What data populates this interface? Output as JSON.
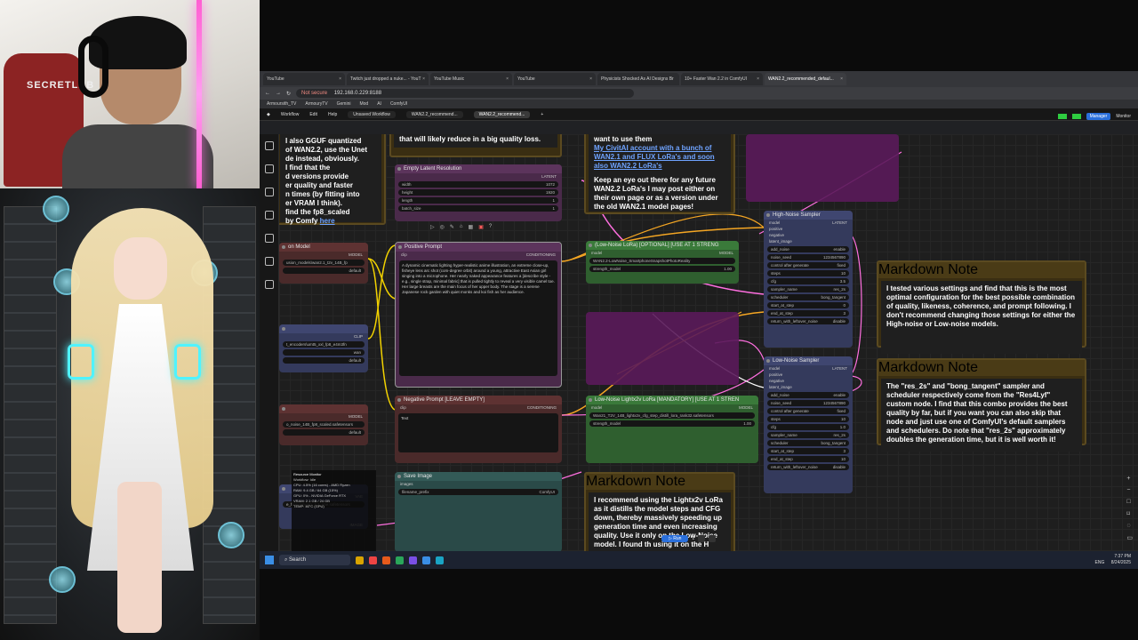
{
  "browser": {
    "tabs": [
      "YouTube",
      "Twitch just dropped a nuke... - YouT",
      "YouTube Music",
      "YouTube",
      "Physicists Shocked As AI Designs Br",
      "10+ Faster Wan 2.2 in ComfyUI",
      "WAN2.2_recommended_defaul..."
    ],
    "not_secure": "Not secure",
    "url": "192.168.0.229:8188",
    "bookmarks": [
      "Armoursith_TV",
      "ArmouryTV",
      "Gemini",
      "Mod",
      "AI",
      "ComfyUI"
    ]
  },
  "comfy": {
    "menu": [
      "Workflow",
      "Edit",
      "Help"
    ],
    "workflow_tabs": [
      "Unsaved Workflow",
      "WAN2.2_recommend...",
      "WAN2.2_recommend..."
    ],
    "manager": "Manager",
    "monitor": "Monitor",
    "run": "Run",
    "run_count": "1"
  },
  "notes": {
    "top_left": {
      "lines": [
        "I also GGUF quantized",
        "of WAN2.2, use the Unet",
        "de instead, obviously.",
        "I find that the",
        "d versions provide",
        "er quality and faster",
        "n times (by fitting into",
        "er VRAM I think).",
        "find the fp8_scaled",
        "by Comfy "
      ],
      "link": "here"
    },
    "top_mid_text": "that will likely reduce in a big quality loss.",
    "top_right": {
      "intro": "want to use them",
      "link": "My CivitAI account with a bunch of WAN2.1 and FLUX LoRa's and soon also WAN2.2 LoRa's",
      "text": "Keep an eye out there for any future WAN2.2 LoRa's I may post either on their own page or as a version under the old WAN2.1 model pages!"
    },
    "md1": {
      "title": "Markdown Note",
      "text": "I tested various settings and find that this is the most optimal configuration for the best possible combination of quality, likeness, coherence, and prompt following. I don't recommend changing those settings for either the High-noise or Low-noise models."
    },
    "md2": {
      "title": "Markdown Note",
      "text": "The \"res_2s\" and \"bong_tangent\" sampler and scheduler respectively come from the \"Res4Lyf\" custom node. I find that this combo provides the best quality by far, but if you want you can also skip that node and just use one of ComfyUI's default samplers and schedulers. Do note that \"res_2s\" approximately doubles the generation time, but it is well worth it!"
    },
    "md3": {
      "title": "Markdown Note",
      "text": "I recommend using the Lightx2v LoRa as it distills the model steps and CFG down, thereby massively speeding up generation time and even increasing quality. Use it only on the Low-Noise model. I found th using it on the H"
    }
  },
  "nodes": {
    "latent": {
      "title": "Empty Latent Resolution",
      "out": "LATENT",
      "widgets": [
        [
          "width",
          "1072"
        ],
        [
          "height",
          "1920"
        ],
        [
          "length",
          "1"
        ],
        [
          "batch_size",
          "1"
        ]
      ]
    },
    "positive": {
      "title": "Positive Prompt",
      "in": "clip",
      "out": "CONDITIONING",
      "text": "A dynamic cinematic lighting hyper-realistic anime illustration, an extreme close-up, fisheye lens arc shot (com-degree orbit) around a young, attractive East Asian girl singing into a microphone. Her nearly naked appearance features a [describe style - e.g., single strap, minimal fabric] that is pulled tightly to reveal a very visible camel toe. Her large breasts are the main focus of her upper body. The stage is a serene Japanese rock garden with quiet monks and koi fish as her audience."
    },
    "negative": {
      "title": "Negative Prompt [LEAVE EMPTY]",
      "in": "clip",
      "out": "CONDITIONING",
      "text": "Text"
    },
    "lora_high": {
      "title": "(Low-Noise LoRa) [OPTIONAL] [USE AT 1 STRENG",
      "in": "model",
      "out": "MODEL",
      "file": "WAN2.2-LowNoise_SmartphoneSnapshotPhotoReality",
      "strength_label": "strength_model",
      "strength": "1.00"
    },
    "lora_low": {
      "title": "Low-Noise Lightx2v LoRa [MANDATORY] [USE AT 1 STREN",
      "in": "model",
      "out": "MODEL",
      "file": "Wan21_T2V_14B_lightx2v_cfg_step_distill_lora_rank32.safetensors",
      "strength_label": "strength_model",
      "strength": "1.00"
    },
    "high_sampler": {
      "title": "High-Noise Sampler",
      "inputs": [
        "model",
        "positive",
        "negative",
        "latent_image"
      ],
      "out": "LATENT",
      "widgets": [
        [
          "add_noise",
          "enable"
        ],
        [
          "noise_seed",
          "1234567890"
        ],
        [
          "control after generate",
          "fixed"
        ],
        [
          "steps",
          "10"
        ],
        [
          "cfg",
          "3.5"
        ],
        [
          "sampler_name",
          "res_2s"
        ],
        [
          "scheduler",
          "bong_tangent"
        ],
        [
          "start_at_step",
          "0"
        ],
        [
          "end_at_step",
          "3"
        ],
        [
          "return_with_leftover_noise",
          "disable"
        ]
      ]
    },
    "low_sampler": {
      "title": "Low-Noise Sampler",
      "inputs": [
        "model",
        "positive",
        "negative",
        "latent_image"
      ],
      "out": "LATENT",
      "widgets": [
        [
          "add_noise",
          "enable"
        ],
        [
          "noise_seed",
          "1234567890"
        ],
        [
          "control after generate",
          "fixed"
        ],
        [
          "steps",
          "10"
        ],
        [
          "cfg",
          "1.0"
        ],
        [
          "sampler_name",
          "res_2s"
        ],
        [
          "scheduler",
          "bong_tangent"
        ],
        [
          "start_at_step",
          "3"
        ],
        [
          "end_at_step",
          "10"
        ],
        [
          "return_with_leftover_noise",
          "disable"
        ]
      ]
    },
    "model_loader": {
      "title": "on Model",
      "out": "MODEL",
      "file": "usion_models\\wan2.1_t2v_14B_fp",
      "dtype": "default"
    },
    "clip_loader": {
      "out": "CLIP",
      "file": "t_encoders\\umt5_xxl_fp8_e4m3fn",
      "type": "wan",
      "device": "default"
    },
    "model_loader2": {
      "out": "MODEL",
      "file": "o_noise_14B_fp8_scaled.safetensors",
      "dtype": "default"
    },
    "save": {
      "title": "Save Image",
      "in": "images",
      "prefix_label": "filename_prefix",
      "prefix": "ComfyUI"
    },
    "vae": {
      "out": "VAE",
      "file": "e_file\\vae\\wan_2.1_vae.safetensors",
      "label2": "IMAGE"
    }
  },
  "resource_monitor": {
    "title": "Resource Monitor",
    "lines": [
      "Workflow: Idle",
      "CPU: 4.5% (16 cores) - AMD Ryzen",
      "RAM: 9.4 GB / 64 GB (15%)",
      "GPU: 0% - NVIDIA GeForce RTX",
      "VRAM: 2.1 GB / 24 GB",
      "TEMP: 46°C (GPU)"
    ]
  },
  "taskbar": {
    "search": "Search",
    "time": "7:37 PM",
    "date": "8/24/2025",
    "lang": "ENG"
  },
  "webcam": {
    "chair_logo": "SECRETLAB"
  },
  "colors": {
    "link_orange": "#f5a623",
    "link_pink": "#ff6fe0",
    "link_yellow": "#f2d200",
    "note_gold": "#5b4a20",
    "accent_blue": "#2a6fdb"
  }
}
